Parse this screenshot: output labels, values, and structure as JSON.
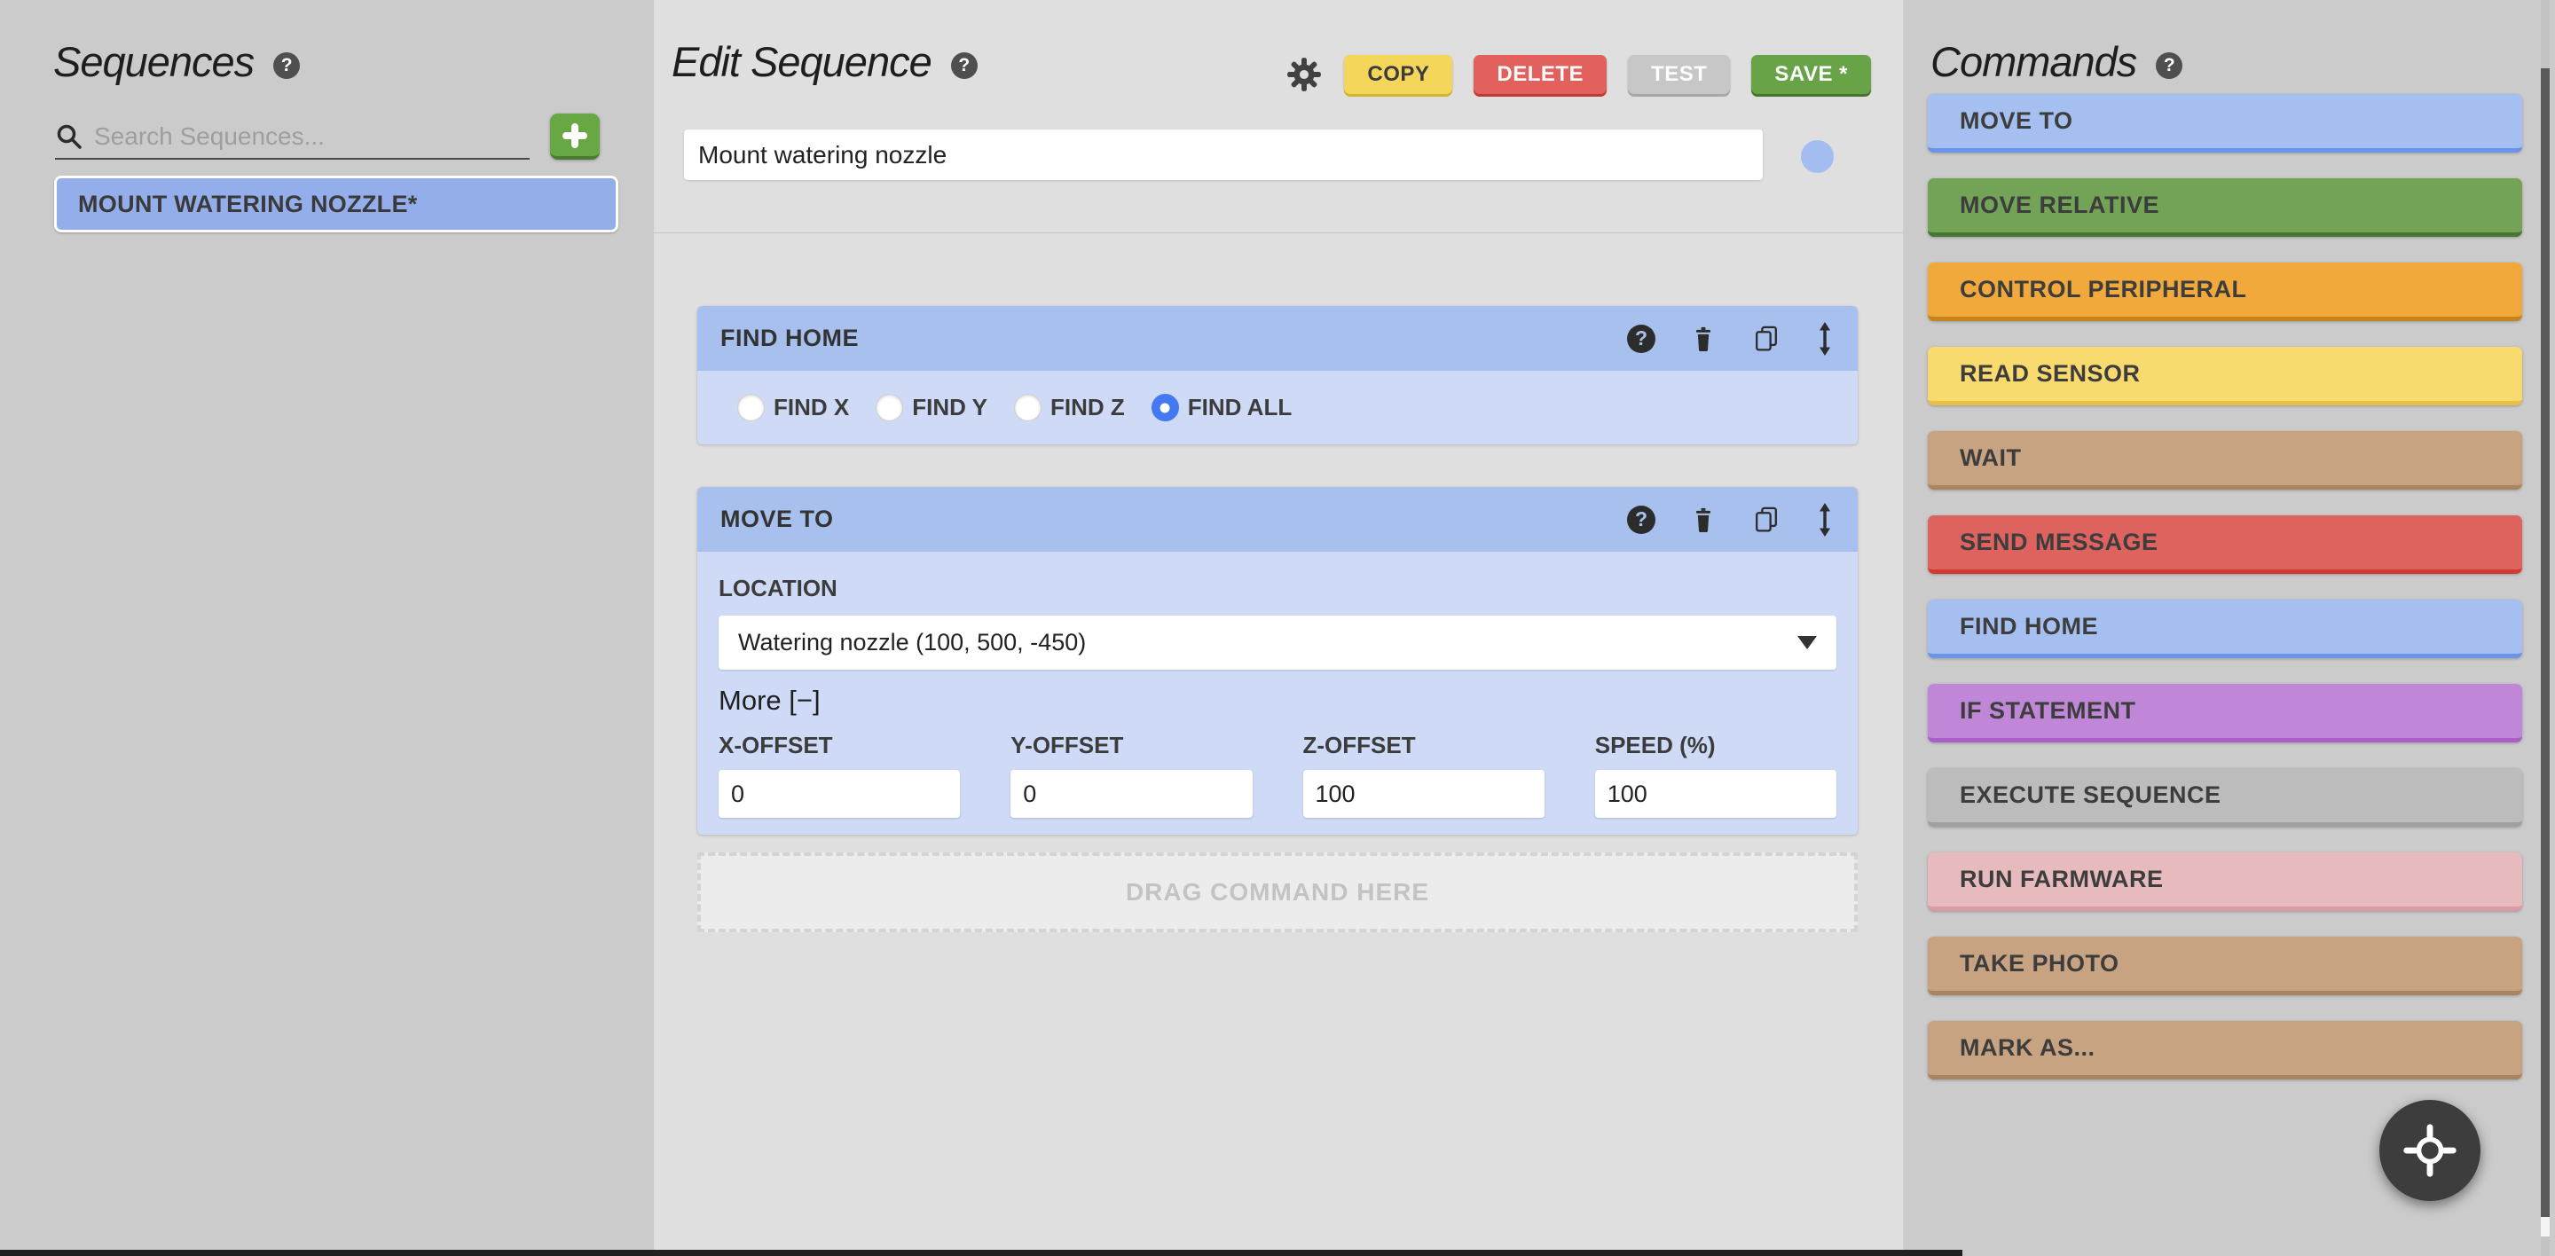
{
  "icons": {
    "question": "?"
  },
  "sequences_panel": {
    "title": "Sequences",
    "search_placeholder": "Search Sequences...",
    "items": [
      {
        "label": "MOUNT WATERING NOZZLE*",
        "bg": "#93aeea"
      }
    ]
  },
  "editor": {
    "title": "Edit Sequence",
    "toolbar": {
      "copy": "COPY",
      "delete": "DELETE",
      "test": "TEST",
      "save": "SAVE *"
    },
    "name_value": "Mount watering nozzle",
    "name_color": "#a3bdf0",
    "steps": [
      {
        "title": "FIND HOME",
        "radios": [
          {
            "label": "FIND X",
            "selected": false
          },
          {
            "label": "FIND Y",
            "selected": false
          },
          {
            "label": "FIND Z",
            "selected": false
          },
          {
            "label": "FIND ALL",
            "selected": true
          }
        ]
      },
      {
        "title": "MOVE TO",
        "location_label": "LOCATION",
        "location_value": "Watering nozzle (100, 500, -450)",
        "more_label": "More [−]",
        "fields": [
          {
            "label": "X-OFFSET",
            "value": "0"
          },
          {
            "label": "Y-OFFSET",
            "value": "0"
          },
          {
            "label": "Z-OFFSET",
            "value": "100"
          },
          {
            "label": "SPEED (%)",
            "value": "100"
          }
        ]
      }
    ],
    "drop_label": "DRAG COMMAND HERE"
  },
  "commands_panel": {
    "title": "Commands",
    "buttons": [
      {
        "label": "MOVE TO",
        "bg": "#a5bff0",
        "edge": "#6b93e8"
      },
      {
        "label": "MOVE RELATIVE",
        "bg": "#73a356",
        "edge": "#47762f"
      },
      {
        "label": "CONTROL PERIPHERAL",
        "bg": "#f2a93c",
        "edge": "#c6851c"
      },
      {
        "label": "READ SENSOR",
        "bg": "#f8da6e",
        "edge": "#e7c145"
      },
      {
        "label": "WAIT",
        "bg": "#c7a381",
        "edge": "#a9855f"
      },
      {
        "label": "SEND MESSAGE",
        "bg": "#de635e",
        "edge": "#d23c30"
      },
      {
        "label": "FIND HOME",
        "bg": "#a5bff0",
        "edge": "#6b93e8"
      },
      {
        "label": "IF STATEMENT",
        "bg": "#c087d8",
        "edge": "#aa5ec6"
      },
      {
        "label": "EXECUTE SEQUENCE",
        "bg": "#bcbcbc",
        "edge": "#a0a0a0"
      },
      {
        "label": "RUN FARMWARE",
        "bg": "#e7babd",
        "edge": "#de9aa2"
      },
      {
        "label": "TAKE PHOTO",
        "bg": "#c7a381",
        "edge": "#a9855f"
      },
      {
        "label": "MARK AS...",
        "bg": "#c7a381",
        "edge": "#a9855f"
      }
    ]
  }
}
